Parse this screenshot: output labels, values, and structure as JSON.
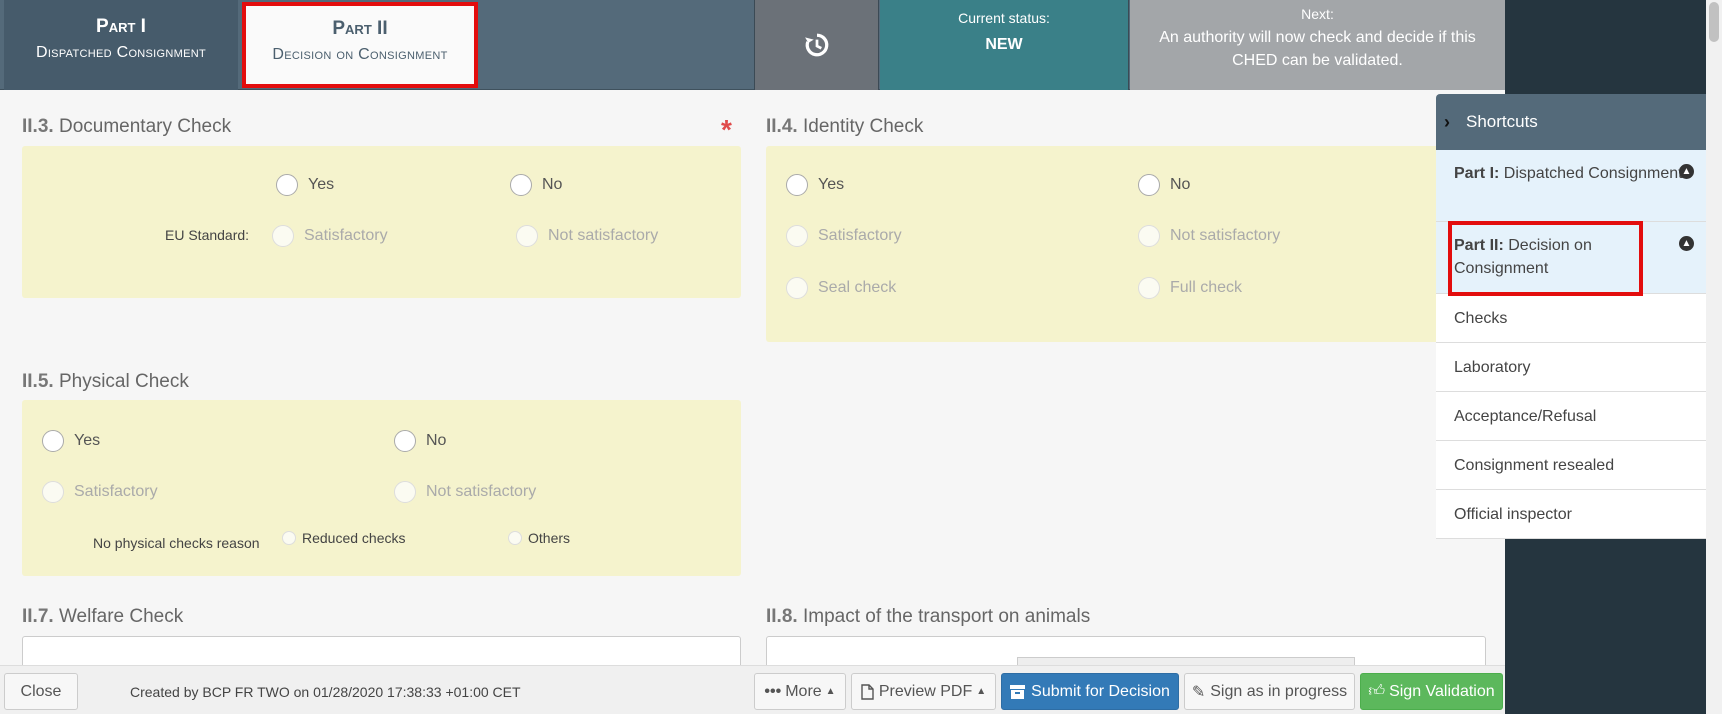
{
  "header": {
    "part1": {
      "title": "Part I",
      "subtitle": "Dispatched Consignment"
    },
    "part2": {
      "title": "Part II",
      "subtitle": "Decision on Consignment"
    },
    "history_icon": "history-icon",
    "status_label": "Current status:",
    "status_value": "NEW",
    "next_label": "Next:",
    "next_text": "An authority will now check and decide if this CHED can be validated."
  },
  "sections": {
    "documentary": {
      "num": "II.3.",
      "title": "Documentary Check",
      "yes": "Yes",
      "no": "No",
      "eu_label": "EU Standard:",
      "satisfactory": "Satisfactory",
      "not_satisfactory": "Not satisfactory"
    },
    "identity": {
      "num": "II.4.",
      "title": "Identity Check",
      "yes": "Yes",
      "no": "No",
      "satisfactory": "Satisfactory",
      "not_satisfactory": "Not satisfactory",
      "seal": "Seal check",
      "full": "Full check"
    },
    "physical": {
      "num": "II.5.",
      "title": "Physical Check",
      "yes": "Yes",
      "no": "No",
      "satisfactory": "Satisfactory",
      "not_satisfactory": "Not satisfactory",
      "reason_label": "No physical checks reason",
      "reduced": "Reduced checks",
      "others": "Others"
    },
    "welfare": {
      "num": "II.7.",
      "title": "Welfare Check"
    },
    "impact": {
      "num": "II.8.",
      "title": "Impact of the transport on animals"
    }
  },
  "shortcuts": {
    "title": "Shortcuts",
    "items": [
      {
        "bold": "Part I:",
        "label": "Dispatched Consignment"
      },
      {
        "bold": "Part II:",
        "label": "Decision on Consignment"
      },
      {
        "label": "Checks"
      },
      {
        "label": "Laboratory"
      },
      {
        "label": "Acceptance/Refusal"
      },
      {
        "label": "Consignment resealed"
      },
      {
        "label": "Official inspector"
      }
    ]
  },
  "footer": {
    "close": "Close",
    "created": "Created by BCP FR TWO on 01/28/2020 17:38:33 +01:00 CET",
    "more": "More",
    "preview": "Preview PDF",
    "submit": "Submit for Decision",
    "sign_progress": "Sign as in progress",
    "sign_validation": "Sign Validation"
  }
}
